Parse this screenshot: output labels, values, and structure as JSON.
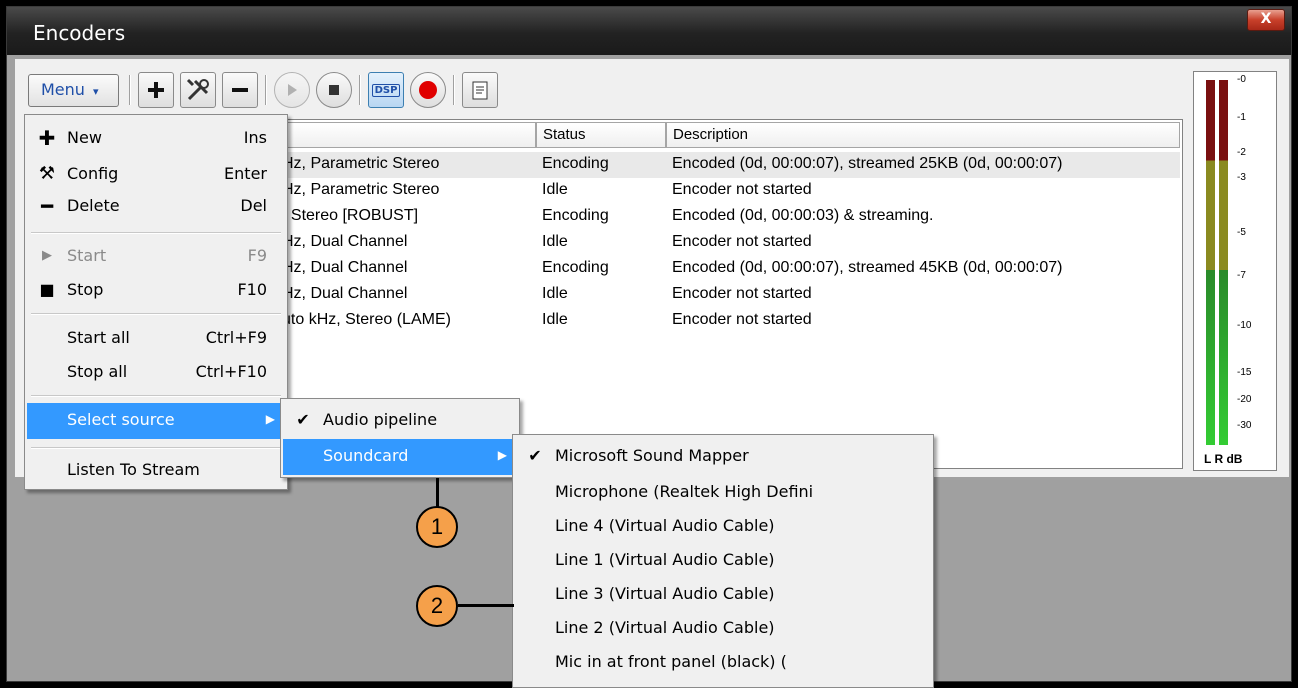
{
  "window": {
    "title": "Encoders",
    "close_glyph": "X"
  },
  "toolbar": {
    "menu_label": "Menu",
    "menu_caret": "▾",
    "buttons": [
      "add-icon",
      "config-icon",
      "remove-icon",
      "play-icon",
      "stop-icon",
      "dsp-icon",
      "record-icon",
      "log-icon"
    ],
    "dsp_label": "DSP"
  },
  "table": {
    "headers": [
      "",
      "Status",
      "Description"
    ],
    "rows": [
      {
        "format": "Hz, Parametric Stereo",
        "status": "Encoding",
        "description": "Encoded (0d, 00:00:07), streamed 25KB (0d, 00:00:07)"
      },
      {
        "format": "Hz, Parametric Stereo",
        "status": "Idle",
        "description": "Encoder not started"
      },
      {
        "format": ", Stereo [ROBUST]",
        "status": "Encoding",
        "description": "Encoded (0d, 00:00:03) & streaming."
      },
      {
        "format": "Hz, Dual Channel",
        "status": "Idle",
        "description": "Encoder not started"
      },
      {
        "format": "Hz, Dual Channel",
        "status": "Encoding",
        "description": "Encoded (0d, 00:00:07), streamed 45KB (0d, 00:00:07)"
      },
      {
        "format": "Hz, Dual Channel",
        "status": "Idle",
        "description": "Encoder not started"
      },
      {
        "format": "uto kHz, Stereo (LAME)",
        "status": "Idle",
        "description": "Encoder not started"
      }
    ]
  },
  "meter": {
    "db_labels": [
      "-0",
      "-1",
      "-2",
      "-3",
      "-5",
      "-7",
      "-10",
      "-15",
      "-20",
      "-30"
    ],
    "footer": "L R  dB"
  },
  "main_menu": {
    "items": [
      {
        "label": "New",
        "shortcut": "Ins",
        "icon": "plus-icon"
      },
      {
        "label": "Config",
        "shortcut": "Enter",
        "icon": "tools-icon"
      },
      {
        "label": "Delete",
        "shortcut": "Del",
        "icon": "minus-icon"
      },
      {
        "label": "Start",
        "shortcut": "F9",
        "icon": "play-icon",
        "disabled": true
      },
      {
        "label": "Stop",
        "shortcut": "F10",
        "icon": "stop-icon"
      },
      {
        "label": "Start all",
        "shortcut": "Ctrl+F9"
      },
      {
        "label": "Stop all",
        "shortcut": "Ctrl+F10"
      },
      {
        "label": "Select source",
        "submenu": true,
        "highlighted": true
      },
      {
        "label": "Listen To Stream"
      }
    ]
  },
  "source_menu": {
    "items": [
      {
        "label": "Audio pipeline",
        "checked": true
      },
      {
        "label": "Soundcard",
        "submenu": true,
        "highlighted": true
      }
    ]
  },
  "soundcard_menu": {
    "items": [
      {
        "label": "Microsoft Sound Mapper",
        "checked": true
      },
      {
        "label": "Microphone (Realtek High Defini"
      },
      {
        "label": "Line 4 (Virtual Audio Cable)"
      },
      {
        "label": "Line 1 (Virtual Audio Cable)"
      },
      {
        "label": "Line 3 (Virtual Audio Cable)"
      },
      {
        "label": "Line 2 (Virtual Audio Cable)"
      },
      {
        "label": "Mic in at front panel (black) ("
      }
    ]
  },
  "callouts": [
    "1",
    "2"
  ],
  "glyphs": {
    "check": "✔",
    "arrow": "▶"
  },
  "colors": {
    "highlight": "#3399ff",
    "callout": "#f5a04a",
    "record": "#e00000"
  }
}
